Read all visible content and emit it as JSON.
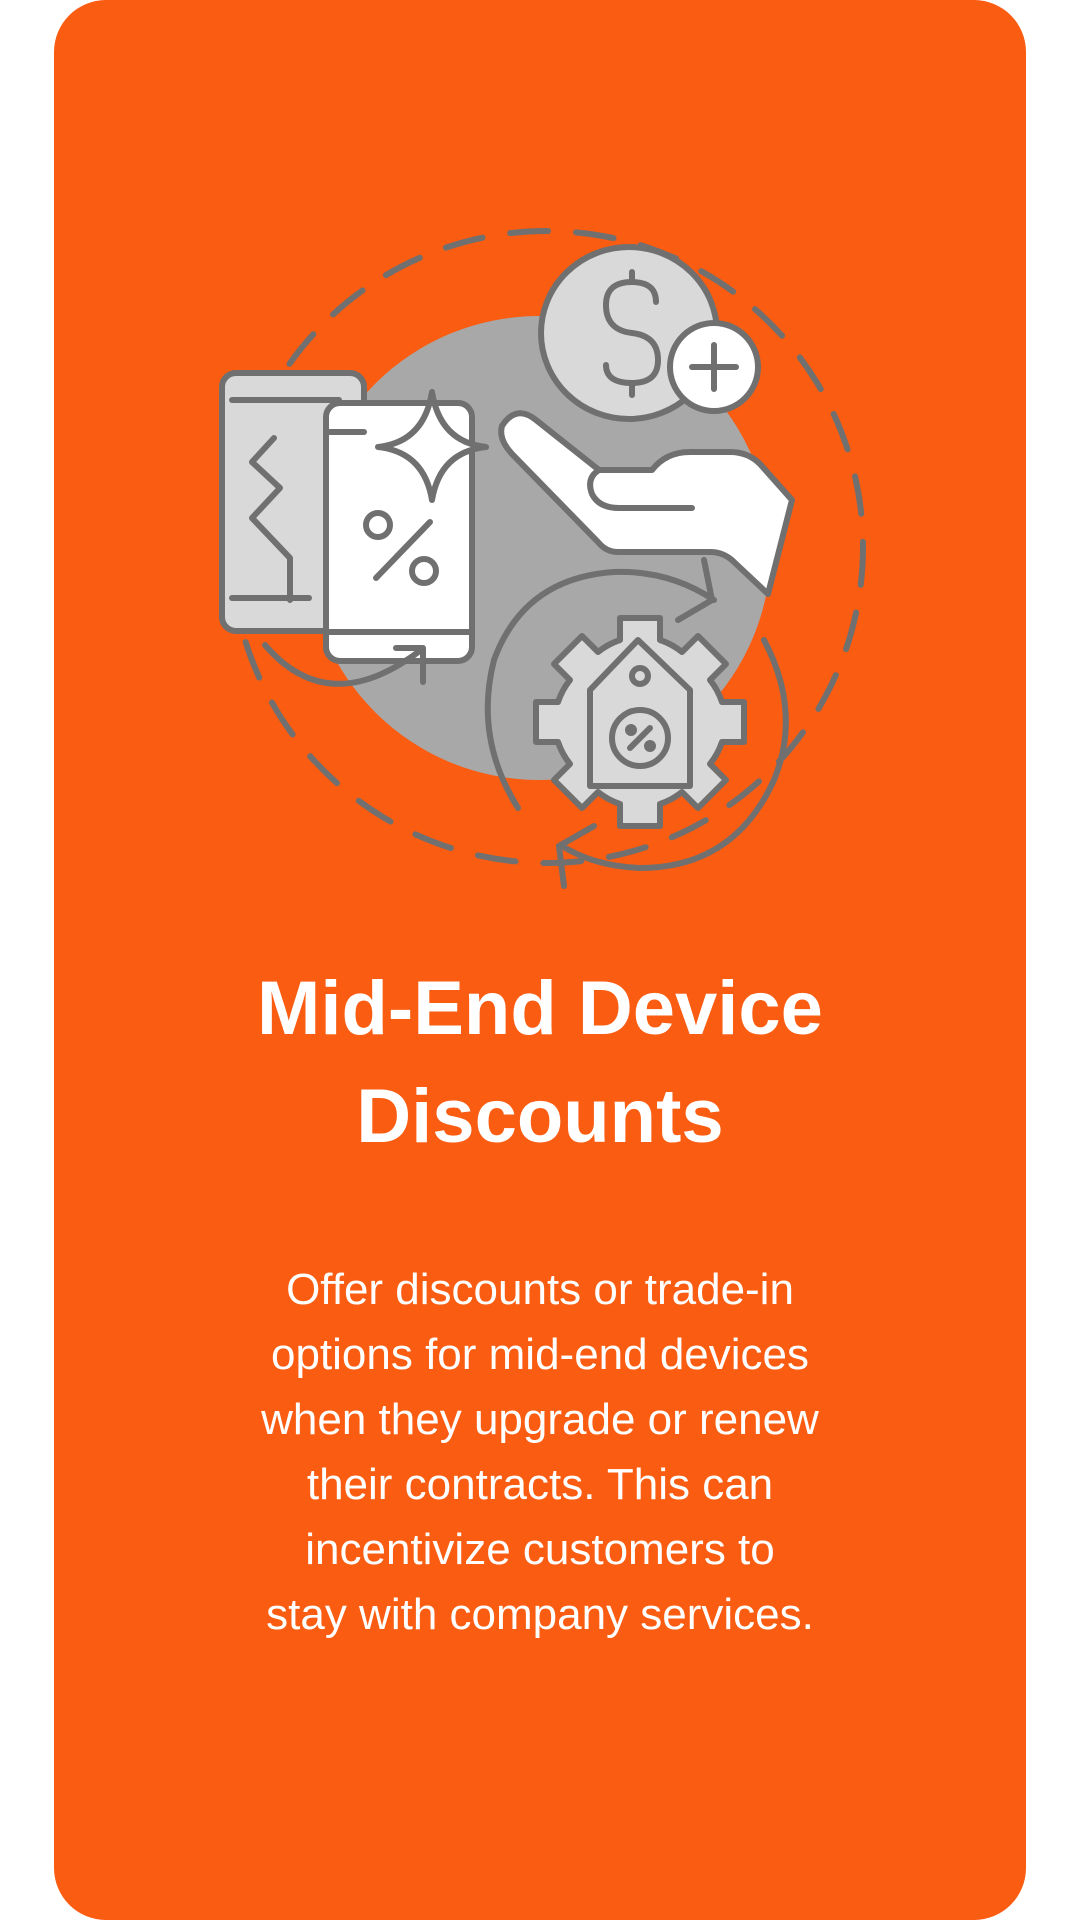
{
  "card": {
    "background_color": "#fa5c11",
    "text_color": "#ffffff",
    "icon_gray": "#707070"
  },
  "illustration": {
    "icons": [
      "smartphones-icon",
      "percent-icon",
      "sparkle-icon",
      "dollar-coin-icon",
      "plus-icon",
      "hand-icon",
      "gear-icon",
      "price-tag-icon",
      "refresh-arrows-icon"
    ]
  },
  "title": {
    "line1": "Mid-End Device",
    "line2": "Discounts"
  },
  "body": {
    "lines": [
      "Offer discounts or trade-in",
      "options for mid-end devices",
      "when they upgrade or renew",
      "their contracts. This can",
      "incentivize customers to",
      "stay with company services."
    ]
  }
}
